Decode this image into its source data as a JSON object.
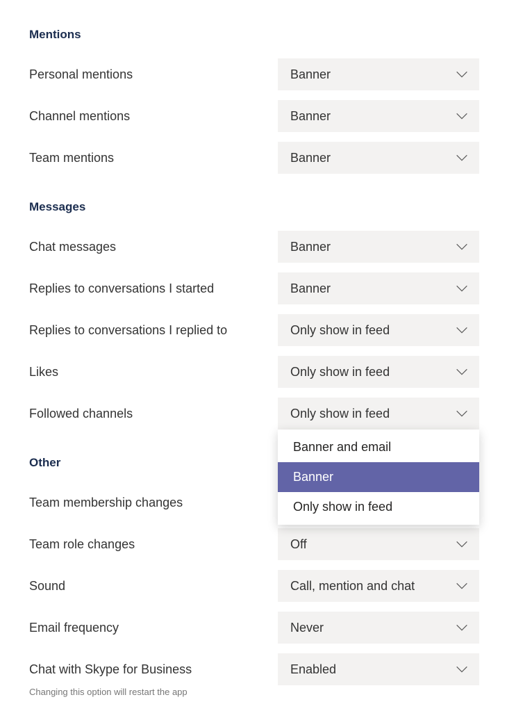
{
  "sections": {
    "mentions": {
      "title": "Mentions",
      "personal": {
        "label": "Personal mentions",
        "value": "Banner"
      },
      "channel": {
        "label": "Channel mentions",
        "value": "Banner"
      },
      "team": {
        "label": "Team mentions",
        "value": "Banner"
      }
    },
    "messages": {
      "title": "Messages",
      "chat": {
        "label": "Chat messages",
        "value": "Banner"
      },
      "replies_started": {
        "label": "Replies to conversations I started",
        "value": "Banner"
      },
      "replies_replied": {
        "label": "Replies to conversations I replied to",
        "value": "Only show in feed"
      },
      "likes": {
        "label": "Likes",
        "value": "Only show in feed"
      },
      "followed": {
        "label": "Followed channels",
        "value": "Only show in feed"
      }
    },
    "other": {
      "title": "Other",
      "membership": {
        "label": "Team membership changes",
        "value": ""
      },
      "role": {
        "label": "Team role changes",
        "value": "Off"
      },
      "sound": {
        "label": "Sound",
        "value": "Call, mention and chat"
      },
      "email": {
        "label": "Email frequency",
        "value": "Never"
      },
      "skype": {
        "label": "Chat with Skype for Business",
        "value": "Enabled",
        "sublabel": "Changing this option will restart the app"
      }
    }
  },
  "dropdown_menu": {
    "opt1": "Banner and email",
    "opt2": "Banner",
    "opt3": "Only show in feed"
  }
}
